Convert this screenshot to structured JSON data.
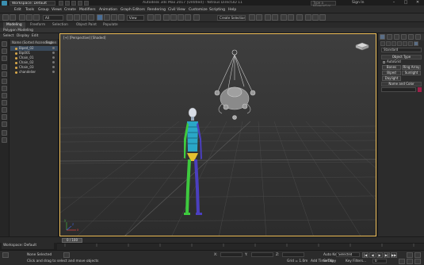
{
  "titlebar": {
    "workspace": "Workspace: Default",
    "window_title": "Autodesk 3ds Max 2017  [Untitled] - Nitrous Direct3D 11",
    "search_placeholder": "Type a keyword or phrase",
    "sign_in": "Sign In"
  },
  "menubar": {
    "items": [
      "Edit",
      "Tools",
      "Group",
      "Views",
      "Create",
      "Modifiers",
      "Animation",
      "Graph Editors",
      "Rendering",
      "Civil View",
      "Customize",
      "Scripting",
      "Help"
    ]
  },
  "toolbar": {
    "selection_filter": "All",
    "view_dropdown": "View",
    "selection_set": "Create Selection Set"
  },
  "ribbon": {
    "tabs": [
      "Modeling",
      "Freeform",
      "Selection",
      "Object Paint",
      "Populate"
    ],
    "active_tab": "Modeling",
    "panel_label": "Polygon Modeling"
  },
  "scene_explorer": {
    "menu": [
      "Select",
      "Display",
      "Edit"
    ],
    "header": "Name (Sorted Ascending)",
    "header_right": "Frozen",
    "rows": [
      "Biped_02",
      "Bip001",
      "Chain_01",
      "Chain_02",
      "Chain_03",
      "chandelier"
    ],
    "workspace_label": "Workspace: Default"
  },
  "viewport": {
    "label": "[+] [Perspective] [Shaded]",
    "axis_x": "x",
    "axis_y": "y",
    "axis_z": "z"
  },
  "command_panel": {
    "dropdown": "Standard",
    "object_type_header": "Object Type",
    "autogrid": "AutoGrid",
    "buttons": [
      "Bones",
      "Ring Array",
      "Biped",
      "Sunlight",
      "Daylight"
    ],
    "name_color_header": "Name and Color",
    "colors": {
      "object": "#a0204a"
    }
  },
  "timeline": {
    "frame": "0 / 100"
  },
  "statusbar": {
    "selection": "None Selected",
    "prompt": "Click and drag to select and move objects",
    "x_label": "X:",
    "y_label": "Y:",
    "z_label": "Z:",
    "grid": "Grid = 1.0m",
    "add_time_tag": "Add Time Tag",
    "auto_key": "Auto Key",
    "set_key": "Set Key",
    "selected": "Selected",
    "key_filters": "Key Filters...",
    "frame_value": "0"
  }
}
